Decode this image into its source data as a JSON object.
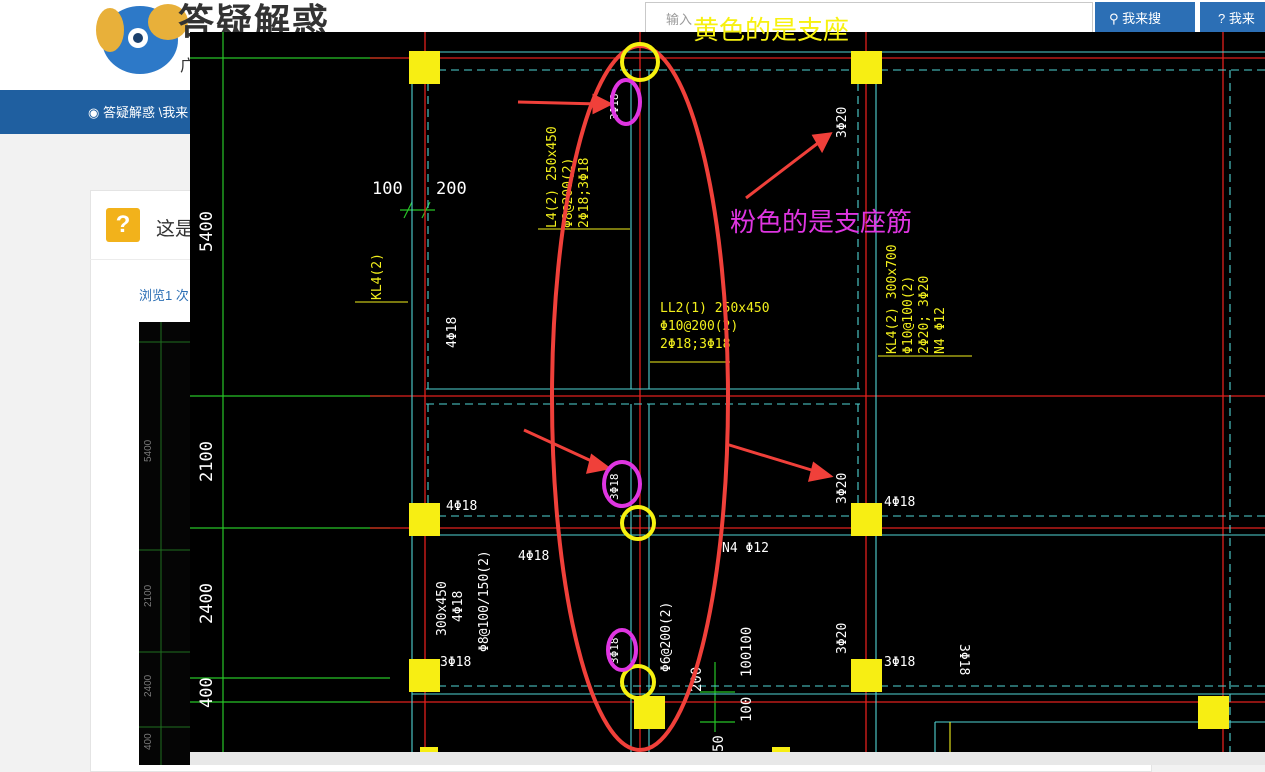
{
  "site": {
    "logo_title": "答疑解惑",
    "logo_sub": "广",
    "search_placeholder": "输入",
    "search_button": "我来搜",
    "ask_button": "我来",
    "breadcrumb": "答疑解惑 \\我来"
  },
  "question": {
    "icon": "?",
    "title": "这是",
    "views": "浏览1 次",
    "thumb_labels": [
      "5400",
      "2100",
      "2400",
      "400"
    ]
  },
  "annotations": {
    "yellow_note": "黄色的是支座",
    "pink_note": "粉色的是支座筋"
  },
  "cad": {
    "dimensions": [
      "5400",
      "2100",
      "2400",
      "400"
    ],
    "left_marks": [
      "100",
      "200"
    ],
    "labels": {
      "kl4": "KL4(2)",
      "l4_line1": "L4(2) 250x450",
      "l4_line2": "Φ8@200(2)",
      "l4_line3": "2Φ18;3Φ18",
      "ll2_line1": "LL2(1) 250x450",
      "ll2_line2": "Φ10@200(2)",
      "ll2_line3": "2Φ18;3Φ18",
      "kl4r_line1": "KL4(2) 300x700",
      "kl4r_line2": "Φ10@100(2)",
      "kl4r_line3": "2Φ20;  3Φ20",
      "kl4r_line4": "N4 Φ12",
      "bar_4phi18_a": "4Φ18",
      "bar_4phi18_b": "4Φ18",
      "bar_4phi18_c": "4Φ18",
      "bar_4phi18_d": "4Φ18",
      "bar_3phi20_a": "3Φ20",
      "bar_3phi20_b": "3Φ20",
      "bar_3phi20_c": "3Φ20",
      "bar_3phi18_a": "3Φ18",
      "bar_3phi18_b": "3Φ18",
      "bar_3phi18_c": "3Φ18",
      "n4": "N4 Φ12",
      "beam_300x450": "300x450",
      "beam_4phi18": "4Φ18",
      "beam_stirrup": "Φ8@100/150(2)",
      "phi6": "Φ6@200(2)",
      "pink_bar_1": "3Φ18",
      "pink_bar_2": "3Φ18",
      "pink_bar_3": "3Φ18",
      "dim_100a": "100",
      "dim_100b": "100",
      "dim_100c": "100",
      "dim_200": "200",
      "dim_50": "50"
    }
  },
  "colors": {
    "nav_blue": "#1f5fa0",
    "support_yellow": "#f7f10f",
    "rebar_pink": "#df35e1",
    "marker_red": "#f0403a",
    "grid_green": "#27c427",
    "beam_cyan": "#4fd4d4"
  }
}
